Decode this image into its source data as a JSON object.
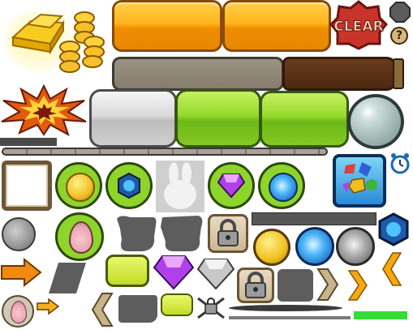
{
  "sprites": {
    "clear_badge": {
      "text": "CLEAR"
    },
    "help_button": {
      "glyph": "?"
    },
    "colors": {
      "orange": "#ffb41c",
      "green": "#8fd42a",
      "silver": "#cfcfcf",
      "brown_bar": "#4e2810",
      "gray_bar": "#8d8474",
      "clear_red": "#c8342a",
      "green_line": "#33dd33"
    },
    "icons": [
      "gold-bars-coins-icon",
      "clear-badge-icon",
      "octagon-icon",
      "help-icon",
      "explosion-icon",
      "gem-slot-icon",
      "coin-icon",
      "blue-gem-icon",
      "bunny-silhouette-icon",
      "purple-diamond-icon",
      "blue-swirl-orb-icon",
      "gems-panel-icon",
      "alarm-clock-icon",
      "stone-icon",
      "egg-icon",
      "shadow-silhouette-icon",
      "lock-icon",
      "arrow-right-icon",
      "chevron-left-icon",
      "chevron-right-icon",
      "chain-lock-icon",
      "silver-diamond-icon"
    ]
  }
}
